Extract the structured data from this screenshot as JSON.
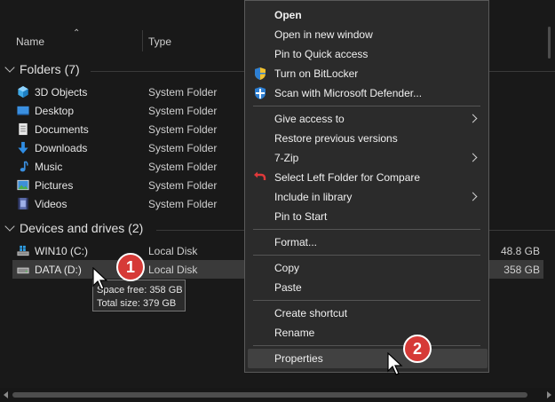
{
  "columns": {
    "name": "Name",
    "type": "Type"
  },
  "groups": {
    "folders": {
      "label": "Folders (7)",
      "items": [
        {
          "name": "3D Objects",
          "type": "System Folder",
          "icon": "3d-objects-icon"
        },
        {
          "name": "Desktop",
          "type": "System Folder",
          "icon": "desktop-icon"
        },
        {
          "name": "Documents",
          "type": "System Folder",
          "icon": "documents-icon"
        },
        {
          "name": "Downloads",
          "type": "System Folder",
          "icon": "downloads-icon"
        },
        {
          "name": "Music",
          "type": "System Folder",
          "icon": "music-icon"
        },
        {
          "name": "Pictures",
          "type": "System Folder",
          "icon": "pictures-icon"
        },
        {
          "name": "Videos",
          "type": "System Folder",
          "icon": "videos-icon"
        }
      ]
    },
    "drives": {
      "label": "Devices and drives (2)",
      "items": [
        {
          "name": "WIN10 (C:)",
          "type": "Local Disk",
          "size": "48.8 GB",
          "icon": "windows-drive-icon"
        },
        {
          "name": "DATA (D:)",
          "type": "Local Disk",
          "size": "358 GB",
          "icon": "drive-icon",
          "selected": true
        }
      ]
    }
  },
  "tooltip": {
    "line1": "Space free: 358 GB",
    "line2": "Total size: 379 GB"
  },
  "context_menu": {
    "items": [
      {
        "label": "Open",
        "bold": true
      },
      {
        "label": "Open in new window"
      },
      {
        "label": "Pin to Quick access"
      },
      {
        "label": "Turn on BitLocker",
        "icon": "bitlocker-shield-icon"
      },
      {
        "label": "Scan with Microsoft Defender...",
        "icon": "defender-icon"
      },
      {
        "label": "Give access to",
        "submenu": true
      },
      {
        "label": "Restore previous versions"
      },
      {
        "label": "7-Zip",
        "submenu": true
      },
      {
        "label": "Select Left Folder for Compare",
        "icon": "compare-icon"
      },
      {
        "label": "Include in library",
        "submenu": true
      },
      {
        "label": "Pin to Start"
      },
      {
        "label": "Format..."
      },
      {
        "label": "Copy"
      },
      {
        "label": "Paste"
      },
      {
        "label": "Create shortcut"
      },
      {
        "label": "Rename"
      },
      {
        "label": "Properties",
        "hovered": true
      }
    ]
  },
  "badges": {
    "step1": "1",
    "step2": "2"
  },
  "colors": {
    "background": "#191919",
    "menu": "#2b2b2b",
    "badge": "#d63a37",
    "selected_row": "#3a3a3a"
  }
}
